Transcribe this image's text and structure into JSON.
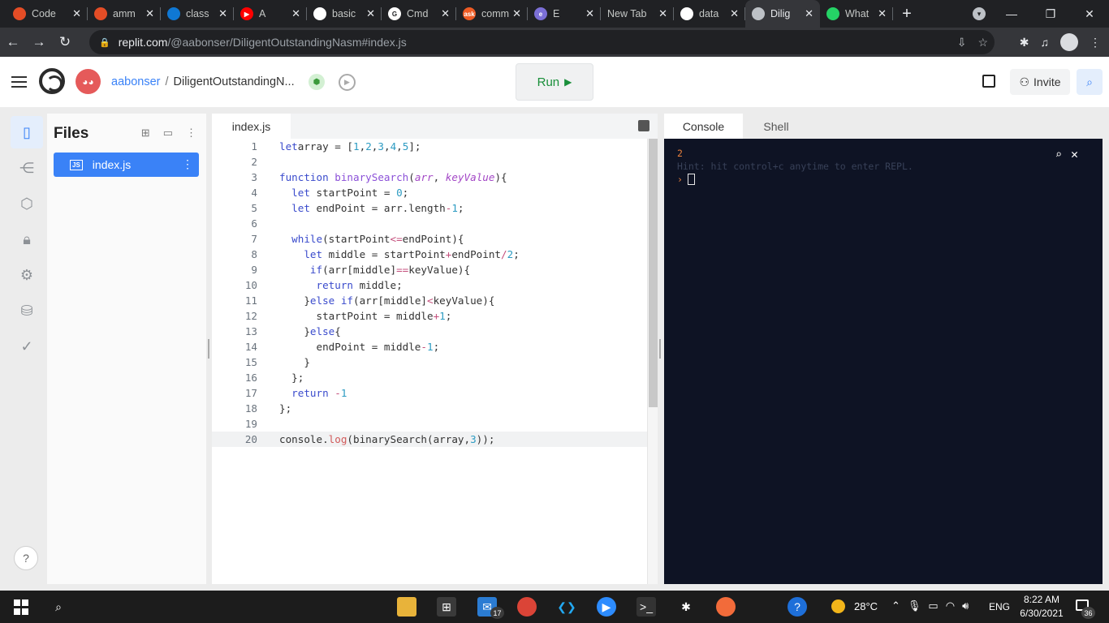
{
  "browser": {
    "tabs": [
      {
        "title": "Code",
        "favicon_color": "#e44d26",
        "favicon_glyph": "",
        "width": 100
      },
      {
        "title": "amm",
        "favicon_color": "#e44d26",
        "favicon_glyph": "",
        "width": 90
      },
      {
        "title": "class",
        "favicon_color": "#0f78d4",
        "favicon_glyph": "",
        "width": 90
      },
      {
        "title": "A",
        "favicon_color": "#ff0000",
        "favicon_glyph": "▶",
        "width": 90
      },
      {
        "title": "basic",
        "favicon_color": "#ffffff",
        "favicon_glyph": "",
        "width": 92
      },
      {
        "title": "Cmd",
        "favicon_color": "#ffffff",
        "favicon_glyph": "G",
        "width": 92
      },
      {
        "title": "comm",
        "favicon_color": "#ee5b24",
        "favicon_glyph": "ask",
        "width": 88
      },
      {
        "title": "E",
        "favicon_color": "#7b6fd6",
        "favicon_glyph": "e",
        "width": 90
      },
      {
        "title": "New Tab",
        "favicon_color": "",
        "favicon_glyph": "",
        "width": 90
      },
      {
        "title": "data",
        "favicon_color": "#ffffff",
        "favicon_glyph": "",
        "width": 88
      },
      {
        "title": "Dilig",
        "favicon_color": "#bdc1c6",
        "favicon_glyph": "",
        "width": 92,
        "active": true
      },
      {
        "title": "What",
        "favicon_color": "#25d366",
        "favicon_glyph": "",
        "width": 90
      }
    ],
    "new_tab_label": "+",
    "url_host": "replit.com",
    "url_path": "/@aabonser/DiligentOutstandingNasm#index.js"
  },
  "header": {
    "username": "aabonser",
    "separator": "/",
    "repl_name": "DiligentOutstandingN...",
    "run_label": "Run",
    "invite_label": "Invite"
  },
  "files": {
    "title": "Files",
    "items": [
      {
        "name": "index.js",
        "badge": "JS"
      }
    ]
  },
  "editor": {
    "tab_label": "index.js",
    "current_line": 20,
    "lines": [
      [
        [
          "kw",
          "let"
        ],
        [
          "",
          "array = ["
        ],
        [
          "num",
          "1"
        ],
        [
          "",
          ","
        ],
        [
          "num",
          "2"
        ],
        [
          "",
          ","
        ],
        [
          "num",
          "3"
        ],
        [
          "",
          ","
        ],
        [
          "num",
          "4"
        ],
        [
          "",
          ","
        ],
        [
          "num",
          "5"
        ],
        [
          "",
          "];"
        ]
      ],
      [],
      [
        [
          "kw",
          "function"
        ],
        [
          "",
          " "
        ],
        [
          "fn",
          "binarySearch"
        ],
        [
          "",
          "("
        ],
        [
          "par",
          "arr"
        ],
        [
          "",
          ", "
        ],
        [
          "par",
          "keyValue"
        ],
        [
          "",
          "){"
        ]
      ],
      [
        [
          "",
          "  "
        ],
        [
          "kw",
          "let"
        ],
        [
          "",
          " startPoint = "
        ],
        [
          "num",
          "0"
        ],
        [
          "",
          ";"
        ]
      ],
      [
        [
          "",
          "  "
        ],
        [
          "kw",
          "let"
        ],
        [
          "",
          " endPoint = arr.length"
        ],
        [
          "op",
          "-"
        ],
        [
          "num",
          "1"
        ],
        [
          "",
          ";"
        ]
      ],
      [],
      [
        [
          "",
          "  "
        ],
        [
          "kw",
          "while"
        ],
        [
          "",
          "(startPoint"
        ],
        [
          "op",
          "<="
        ],
        [
          "",
          "endPoint){"
        ]
      ],
      [
        [
          "",
          "    "
        ],
        [
          "kw",
          "let"
        ],
        [
          "",
          " middle = startPoint"
        ],
        [
          "op",
          "+"
        ],
        [
          "",
          "endPoint"
        ],
        [
          "op",
          "/"
        ],
        [
          "num",
          "2"
        ],
        [
          "",
          ";"
        ]
      ],
      [
        [
          "",
          "     "
        ],
        [
          "kw",
          "if"
        ],
        [
          "",
          "(arr[middle]"
        ],
        [
          "op",
          "=="
        ],
        [
          "",
          "keyValue){"
        ]
      ],
      [
        [
          "",
          "      "
        ],
        [
          "kw",
          "return"
        ],
        [
          "",
          " middle;"
        ]
      ],
      [
        [
          "",
          "    }"
        ],
        [
          "kw",
          "else if"
        ],
        [
          "",
          "(arr[middle]"
        ],
        [
          "op",
          "<"
        ],
        [
          "",
          "keyValue){"
        ]
      ],
      [
        [
          "",
          "      startPoint = middle"
        ],
        [
          "op",
          "+"
        ],
        [
          "num",
          "1"
        ],
        [
          "",
          ";"
        ]
      ],
      [
        [
          "",
          "    }"
        ],
        [
          "kw",
          "else"
        ],
        [
          "",
          "{"
        ]
      ],
      [
        [
          "",
          "      endPoint = middle"
        ],
        [
          "op",
          "-"
        ],
        [
          "num",
          "1"
        ],
        [
          "",
          ";"
        ]
      ],
      [
        [
          "",
          "    }"
        ]
      ],
      [
        [
          "",
          "  };"
        ]
      ],
      [
        [
          "",
          "  "
        ],
        [
          "kw",
          "return"
        ],
        [
          "",
          " "
        ],
        [
          "op",
          "-"
        ],
        [
          "num",
          "1"
        ]
      ],
      [
        [
          "",
          "};"
        ]
      ],
      [],
      [
        [
          "",
          "console."
        ],
        [
          "lg",
          "log"
        ],
        [
          "",
          "(binarySearch(array,"
        ],
        [
          "num",
          "3"
        ],
        [
          "",
          "));"
        ]
      ]
    ]
  },
  "console": {
    "tabs": [
      "Console",
      "Shell"
    ],
    "output": "2",
    "hint": "Hint: hit control+c anytime to enter REPL.",
    "prompt": "›"
  },
  "taskbar": {
    "mail_count": "17",
    "temperature": "28°C",
    "language": "ENG",
    "time": "8:22 AM",
    "date": "6/30/2021",
    "notification_count": "36"
  }
}
